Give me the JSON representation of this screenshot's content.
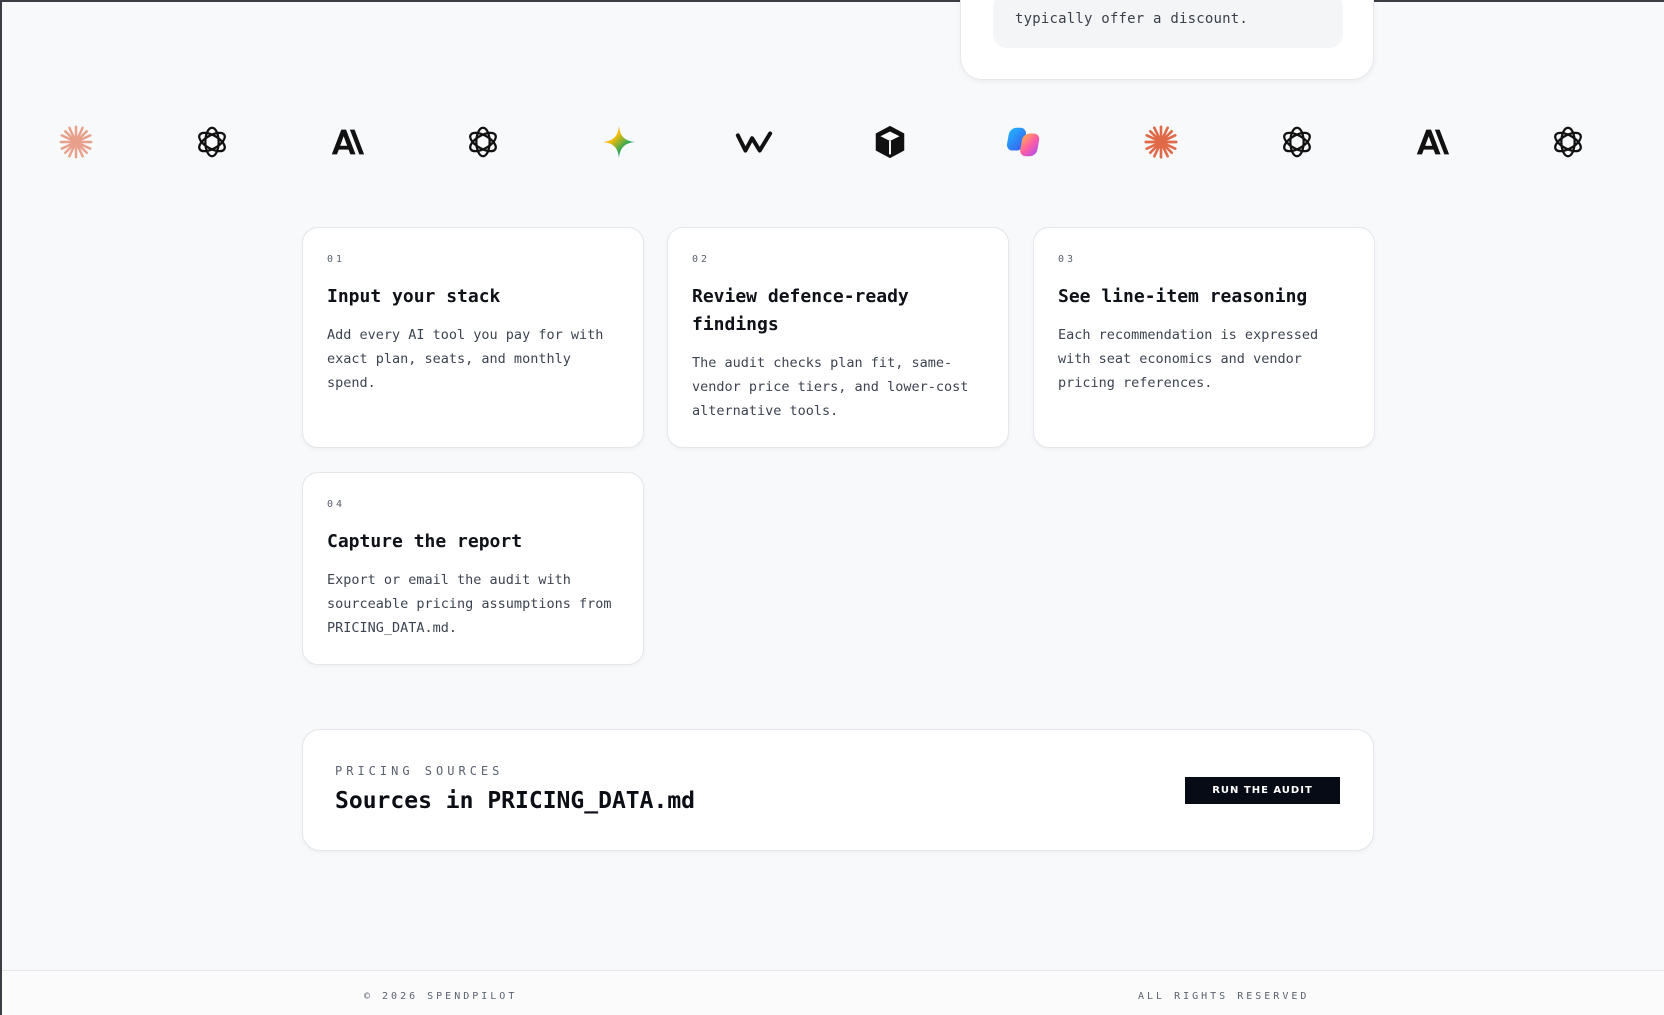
{
  "top_card": {
    "text": "typically offer a discount."
  },
  "logos": [
    {
      "icon": "claude-burst-icon",
      "color": "#e8a08a"
    },
    {
      "icon": "openai-knot-icon",
      "color": "#111111"
    },
    {
      "icon": "anthropic-ai-icon",
      "color": "#111111"
    },
    {
      "icon": "openai-knot-icon",
      "color": "#111111"
    },
    {
      "icon": "gemini-star-icon",
      "color": "#4a8cf0"
    },
    {
      "icon": "windsurf-w-icon",
      "color": "#111111"
    },
    {
      "icon": "cube-icon",
      "color": "#111111"
    },
    {
      "icon": "copilot-icon",
      "color": "#6a5cf0"
    },
    {
      "icon": "claude-burst-icon",
      "color": "#e06a48"
    },
    {
      "icon": "openai-knot-icon",
      "color": "#111111"
    },
    {
      "icon": "anthropic-ai-icon",
      "color": "#111111"
    },
    {
      "icon": "openai-knot-icon",
      "color": "#111111"
    }
  ],
  "steps": [
    {
      "num": "01",
      "title": "Input your stack",
      "desc": "Add every AI tool you pay for with exact plan, seats, and monthly spend."
    },
    {
      "num": "02",
      "title": "Review defence-ready findings",
      "desc": "The audit checks plan fit, same-vendor price tiers, and lower-cost alternative tools."
    },
    {
      "num": "03",
      "title": "See line-item reasoning",
      "desc": "Each recommendation is expressed with seat economics and vendor pricing references."
    },
    {
      "num": "04",
      "title": "Capture the report",
      "desc": "Export or email the audit with sourceable pricing assumptions from PRICING_DATA.md."
    }
  ],
  "sources": {
    "eyebrow": "PRICING SOURCES",
    "heading": "Sources in PRICING_DATA.md",
    "cta_label": "RUN THE AUDIT"
  },
  "footer": {
    "copyright": "© 2026 SPENDPILOT",
    "rights": "ALL RIGHTS RESERVED"
  }
}
